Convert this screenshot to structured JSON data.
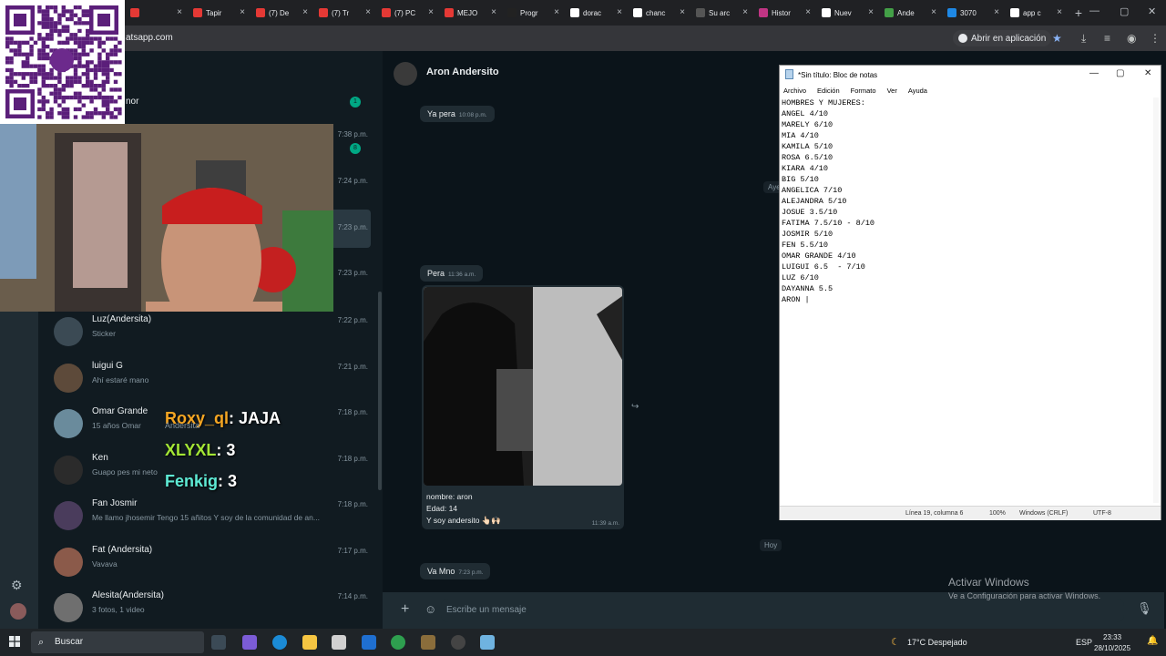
{
  "browser": {
    "tabs": [
      {
        "label": "",
        "color": "#e53935"
      },
      {
        "label": "Tapir",
        "color": "#e53935"
      },
      {
        "label": "(7) De",
        "color": "#e53935"
      },
      {
        "label": "(7) Tr",
        "color": "#e53935"
      },
      {
        "label": "(7) PC",
        "color": "#e53935"
      },
      {
        "label": "MEJO",
        "color": "#e53935"
      },
      {
        "label": "Progr",
        "color": "#222222"
      },
      {
        "label": "dorac",
        "color": "#ffffff"
      },
      {
        "label": "chanc",
        "color": "#ffffff"
      },
      {
        "label": "Su arc",
        "color": "#555555"
      },
      {
        "label": "Histor",
        "color": "#c13584"
      },
      {
        "label": "Nuev",
        "color": "#ffffff"
      },
      {
        "label": "Ande",
        "color": "#43a047"
      },
      {
        "label": "3070",
        "color": "#1e88e5"
      },
      {
        "label": "app c",
        "color": "#ffffff"
      }
    ],
    "url": "atsapp.com",
    "open_in_app": "Abrir en aplicación"
  },
  "chats": [
    {
      "name": "Luz(Andersita)",
      "preview": "Sticker",
      "time": "7:22 p.m."
    },
    {
      "name": "luigui G",
      "preview": "Ahí estaré mano",
      "time": "7:21 p.m."
    },
    {
      "name": "Omar Grande",
      "preview": "15 años Omar",
      "time": "7:18 p.m."
    },
    {
      "name": "Ken",
      "preview": "Guapo pes mi neto",
      "time": "7:18 p.m."
    },
    {
      "name": "Fan Josmir",
      "preview": "Me llamo jhosemir Tengo 15 añitos  Y soy de la comunidad de an...",
      "time": "7:18 p.m."
    },
    {
      "name": "Fat (Andersita)",
      "preview": "Vavava",
      "time": "7:17 p.m."
    },
    {
      "name": "Alesita(Andersita)",
      "preview": "3 fotos, 1 video",
      "time": "7:14 p.m."
    }
  ],
  "partial_chat": {
    "name_fragment": "nor"
  },
  "upper_times": [
    {
      "text": "7:38 p.m.",
      "badge": "8"
    },
    {
      "text": "7:24 p.m."
    },
    {
      "text": "7:23 p.m."
    },
    {
      "text": "7:23 p.m."
    }
  ],
  "top_badge": "1",
  "stream_overlay": [
    {
      "user": "Roxy_ql",
      "user_color": "#f5a623",
      "text": ": JAJA"
    },
    {
      "user": "XLYXL",
      "user_color": "#a3e635",
      "text": ": 3"
    },
    {
      "user": "Fenkig",
      "user_color": "#5eead4",
      "text": ": 3"
    }
  ],
  "stream_overlay_partial": "Andersita",
  "conversation": {
    "contact": "Aron Andersito",
    "messages": [
      {
        "text": "Ya pera",
        "time": "10:08 p.m."
      },
      {
        "text": "Pera",
        "time": "11:36 a.m."
      },
      {
        "text": "Va Mno",
        "time": "7:23 p.m."
      }
    ],
    "photo_caption": [
      "nombre: aron",
      "Edad: 14",
      "Y soy andersito 👆🏻🙌🏻"
    ],
    "photo_time": "11:39 a.m.",
    "day_chips": [
      "Ayer",
      "Hoy"
    ],
    "composer_placeholder": "Escribe un mensaje"
  },
  "notepad": {
    "title": "*Sin título: Bloc de notas",
    "menu": [
      "Archivo",
      "Edición",
      "Formato",
      "Ver",
      "Ayuda"
    ],
    "text": "HOMBRES Y MUJERES:\nANGEL 4/10\nMARELY 6/10\nMIA 4/10\nKAMILA 5/10\nROSA 6.5/10\nKIARA 4/10\nBIG 5/10\nANGELICA 7/10\nALEJANDRA 5/10\nJOSUE 3.5/10\nFATIMA 7.5/10 - 8/10\nJOSMIR 5/10\nFEN 5.5/10\nOMAR GRANDE 4/10\nLUIGUI 6.5  - 7/10\nLUZ 6/10\nDAYANNA 5.5\nARON |",
    "status": {
      "position": "Línea 19, columna 6",
      "zoom": "100%",
      "eol": "Windows (CRLF)",
      "encoding": "UTF-8"
    }
  },
  "activate_windows": {
    "title": "Activar Windows",
    "subtitle": "Ve a Configuración para activar Windows."
  },
  "taskbar": {
    "search": "Buscar",
    "weather": "17°C Despejado",
    "lang": "ESP",
    "time": "23:33",
    "date": "28/10/2025"
  }
}
